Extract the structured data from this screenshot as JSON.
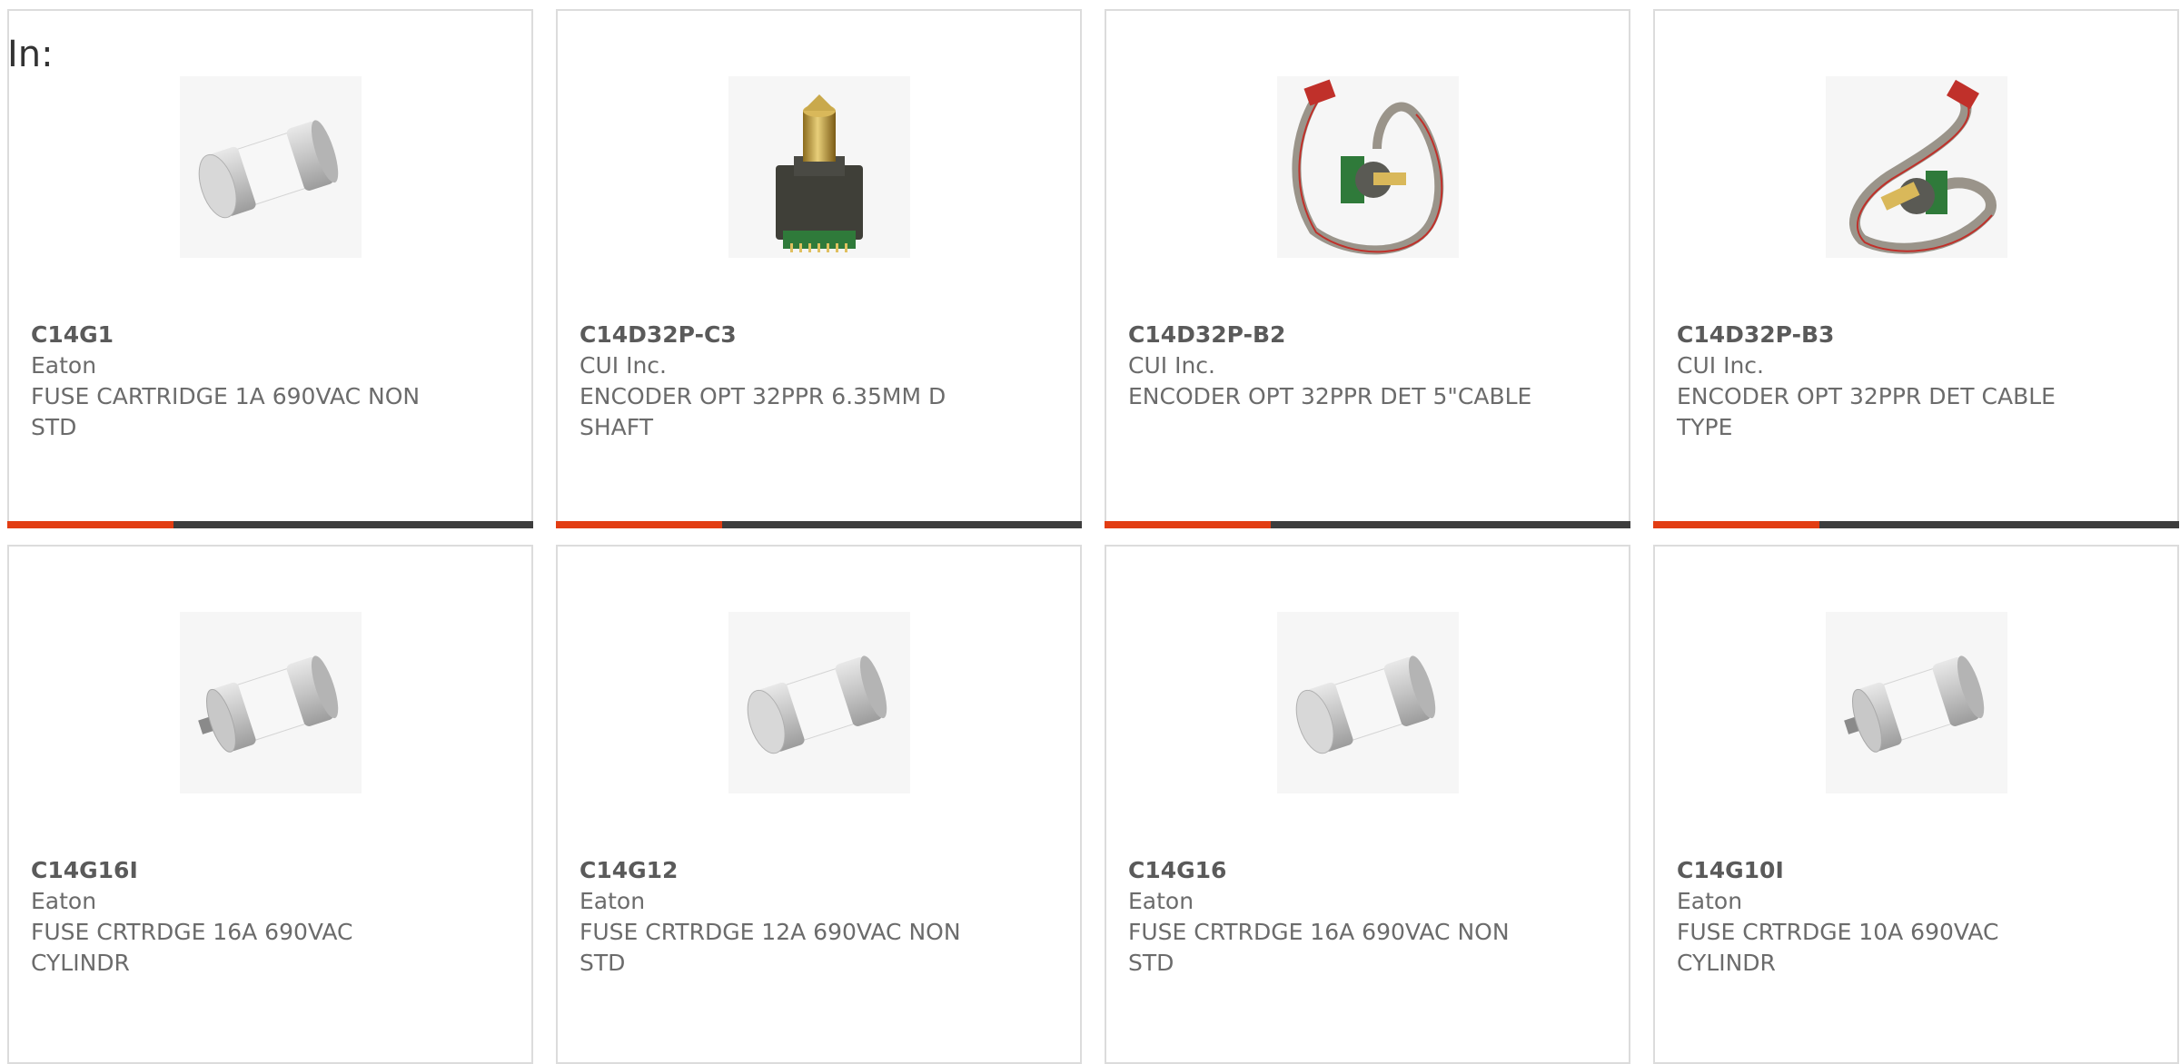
{
  "header": {
    "in_label": "In:"
  },
  "colors": {
    "accent": "#e23d13",
    "bar": "#3d3d3d",
    "border": "#dcdcdc",
    "text": "#6b6b6b"
  },
  "products": [
    {
      "part_number": "C14G1",
      "manufacturer": "Eaton",
      "description": "FUSE CARTRIDGE 1A 690VAC NON STD",
      "image": "fuse-cartridge-icon"
    },
    {
      "part_number": "C14D32P-C3",
      "manufacturer": "CUI Inc.",
      "description": "ENCODER OPT 32PPR 6.35MM D SHAFT",
      "image": "encoder-shaft-icon"
    },
    {
      "part_number": "C14D32P-B2",
      "manufacturer": "CUI Inc.",
      "description": "ENCODER OPT 32PPR DET 5\"CABLE",
      "image": "encoder-cable-icon"
    },
    {
      "part_number": "C14D32P-B3",
      "manufacturer": "CUI Inc.",
      "description": "ENCODER OPT 32PPR DET CABLE TYPE",
      "image": "encoder-cable-icon"
    },
    {
      "part_number": "C14G16I",
      "manufacturer": "Eaton",
      "description": "FUSE CRTRDGE 16A 690VAC CYLINDR",
      "image": "fuse-cartridge-pin-icon"
    },
    {
      "part_number": "C14G12",
      "manufacturer": "Eaton",
      "description": "FUSE CRTRDGE 12A 690VAC NON STD",
      "image": "fuse-cartridge-icon"
    },
    {
      "part_number": "C14G16",
      "manufacturer": "Eaton",
      "description": "FUSE CRTRDGE 16A 690VAC NON STD",
      "image": "fuse-cartridge-icon"
    },
    {
      "part_number": "C14G10I",
      "manufacturer": "Eaton",
      "description": "FUSE CRTRDGE 10A 690VAC CYLINDR",
      "image": "fuse-cartridge-pin-icon"
    }
  ]
}
